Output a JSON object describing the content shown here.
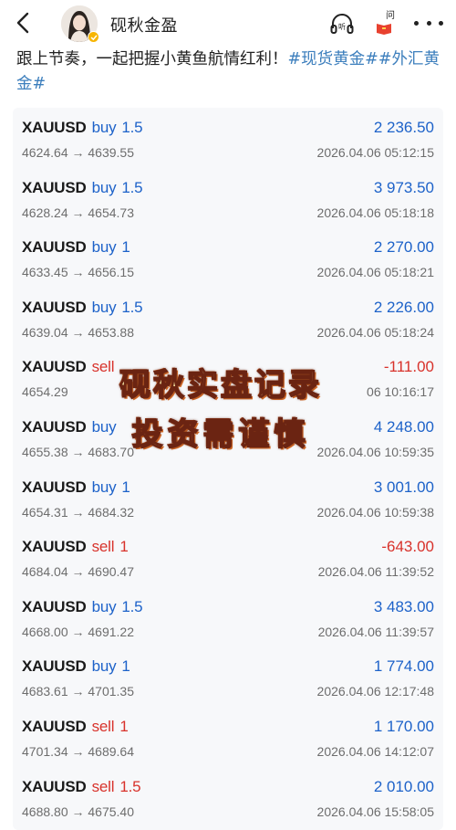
{
  "header": {
    "account_name": "砚秋金盈",
    "icons": [
      "back-arrow-icon",
      "avatar",
      "verified-badge-icon",
      "listen-icon",
      "ask-icon",
      "more-icon"
    ],
    "ask_label": "问"
  },
  "post": {
    "text": "跟上节奏，一起把握小黄鱼航情红利！",
    "tag1": "#现货黄金#",
    "tag2": "#外汇黄金#"
  },
  "trades": [
    {
      "symbol": "XAUUSD",
      "side": "buy",
      "lots": "1.5",
      "prices": "4624.64 → 4639.55",
      "profit": "2 236.50",
      "time": "2026.04.06 05:12:15"
    },
    {
      "symbol": "XAUUSD",
      "side": "buy",
      "lots": "1.5",
      "prices": "4628.24 → 4654.73",
      "profit": "3 973.50",
      "time": "2026.04.06 05:18:18"
    },
    {
      "symbol": "XAUUSD",
      "side": "buy",
      "lots": "1",
      "prices": "4633.45 → 4656.15",
      "profit": "2 270.00",
      "time": "2026.04.06 05:18:21"
    },
    {
      "symbol": "XAUUSD",
      "side": "buy",
      "lots": "1.5",
      "prices": "4639.04 → 4653.88",
      "profit": "2 226.00",
      "time": "2026.04.06 05:18:24"
    },
    {
      "symbol": "XAUUSD",
      "side": "sell",
      "lots": "",
      "prices": "4654.29",
      "profit": "-111.00",
      "time": "06 10:16:17"
    },
    {
      "symbol": "XAUUSD",
      "side": "buy",
      "lots": "",
      "prices": "4655.38 → 4683.70",
      "profit": "4 248.00",
      "time": "2026.04.06 10:59:35"
    },
    {
      "symbol": "XAUUSD",
      "side": "buy",
      "lots": "1",
      "prices": "4654.31 → 4684.32",
      "profit": "3 001.00",
      "time": "2026.04.06 10:59:38"
    },
    {
      "symbol": "XAUUSD",
      "side": "sell",
      "lots": "1",
      "prices": "4684.04 → 4690.47",
      "profit": "-643.00",
      "time": "2026.04.06 11:39:52"
    },
    {
      "symbol": "XAUUSD",
      "side": "buy",
      "lots": "1.5",
      "prices": "4668.00 → 4691.22",
      "profit": "3 483.00",
      "time": "2026.04.06 11:39:57"
    },
    {
      "symbol": "XAUUSD",
      "side": "buy",
      "lots": "1",
      "prices": "4683.61 → 4701.35",
      "profit": "1 774.00",
      "time": "2026.04.06 12:17:48"
    },
    {
      "symbol": "XAUUSD",
      "side": "sell",
      "lots": "1",
      "prices": "4701.34 → 4689.64",
      "profit": "1 170.00",
      "time": "2026.04.06 14:12:07"
    },
    {
      "symbol": "XAUUSD",
      "side": "sell",
      "lots": "1.5",
      "prices": "4688.80 → 4675.40",
      "profit": "2 010.00",
      "time": "2026.04.06 15:58:05"
    }
  ],
  "overlay": {
    "line1": "砚秋实盘记录",
    "line2": "投资需谨慎"
  },
  "colors": {
    "buy": "#1d62c9",
    "sell": "#d8322b",
    "tag": "#3d7fbd",
    "card_bg": "#f7f8fa"
  }
}
